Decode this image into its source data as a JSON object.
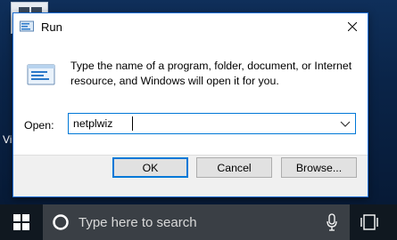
{
  "dialog": {
    "title": "Run",
    "description": "Type the name of a program, folder, document, or Internet resource, and Windows will open it for you.",
    "open_label": "Open:",
    "open_value": "netplwiz",
    "buttons": {
      "ok": "OK",
      "cancel": "Cancel",
      "browse": "Browse..."
    },
    "icons": {
      "title": "run-icon",
      "body": "run-icon",
      "close": "close-icon",
      "dropdown": "chevron-down-icon"
    }
  },
  "desktop": {
    "partial_text": "Vi"
  },
  "taskbar": {
    "search_placeholder": "Type here to search",
    "icons": [
      "windows-logo-icon",
      "cortana-icon",
      "microphone-icon",
      "task-view-icon"
    ]
  },
  "colors": {
    "accent": "#0078d7",
    "taskbar": "#101820",
    "search_box": "#3a3f45"
  }
}
